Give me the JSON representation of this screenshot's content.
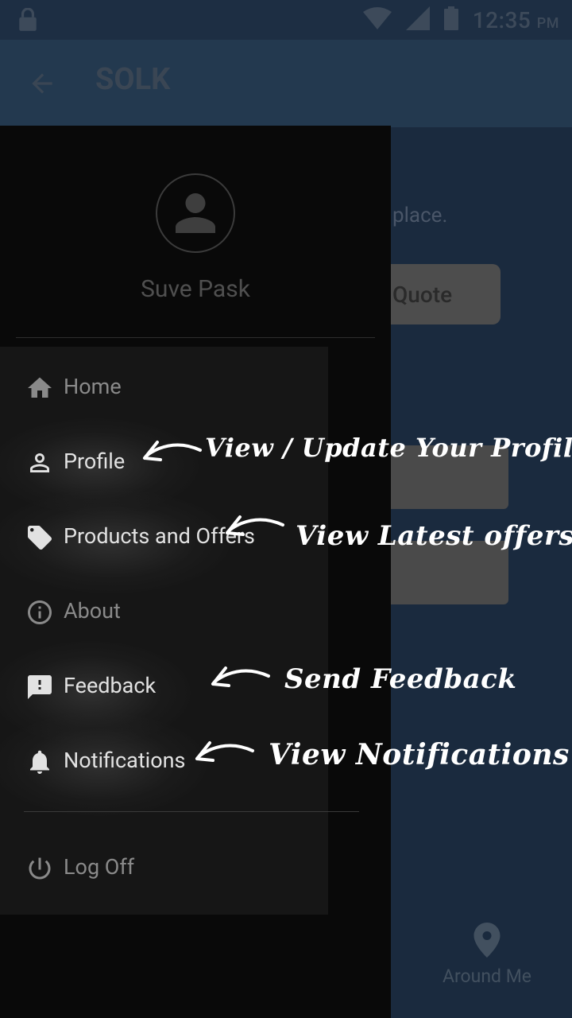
{
  "status_bar": {
    "time": "12:35",
    "ampm": "PM"
  },
  "app_bar": {
    "title": "SOLK"
  },
  "main": {
    "partial_text": "place.",
    "quote_button": "Quote",
    "bottom_nav": {
      "around_me": "Around Me"
    }
  },
  "drawer": {
    "username": "Suve Pask",
    "items": [
      {
        "label": "Home",
        "icon": "home-icon"
      },
      {
        "label": "Profile",
        "icon": "person-icon"
      },
      {
        "label": "Products and Offers",
        "icon": "tag-icon"
      },
      {
        "label": "About",
        "icon": "info-icon"
      },
      {
        "label": "Feedback",
        "icon": "feedback-icon"
      },
      {
        "label": "Notifications",
        "icon": "bell-icon"
      }
    ],
    "logoff": {
      "label": "Log Off",
      "icon": "power-icon"
    }
  },
  "annotations": {
    "profile": "View / Update Your Profile",
    "offers": "View Latest offers",
    "feedback": "Send Feedback",
    "notifications": "View Notifications"
  }
}
